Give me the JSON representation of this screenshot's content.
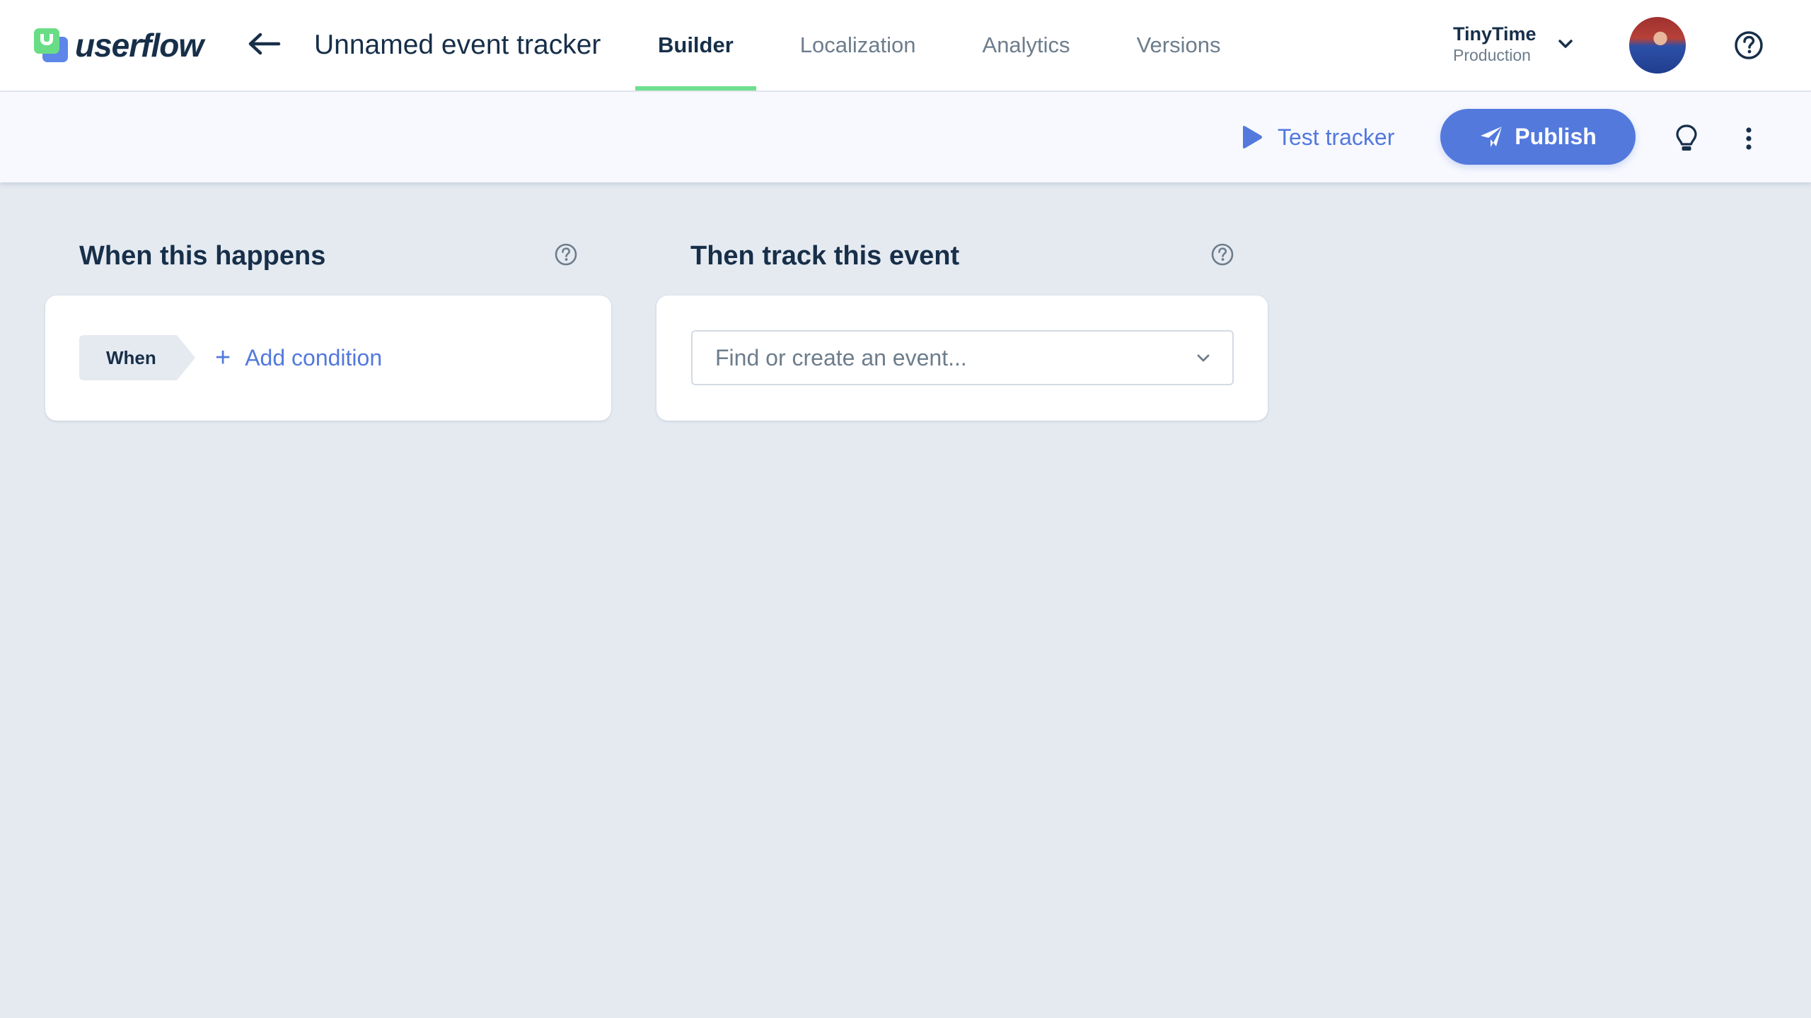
{
  "header": {
    "logo_text": "userflow",
    "title": "Unnamed event tracker",
    "tabs": [
      {
        "label": "Builder",
        "active": true
      },
      {
        "label": "Localization",
        "active": false
      },
      {
        "label": "Analytics",
        "active": false
      },
      {
        "label": "Versions",
        "active": false
      }
    ],
    "workspace": {
      "name": "TinyTime",
      "environment": "Production"
    },
    "icons": {
      "back": "arrow-left-icon",
      "workspace_dropdown": "chevron-down-icon",
      "avatar": "user-avatar",
      "help": "question-circle-icon"
    }
  },
  "toolbar": {
    "test_label": "Test tracker",
    "publish_label": "Publish",
    "icons": {
      "test": "play-icon",
      "publish": "paper-plane-icon",
      "tips": "lightbulb-icon",
      "more": "kebab-menu-icon"
    }
  },
  "colors": {
    "accent": "#5379dd",
    "active_tab_underline": "#6ee08f",
    "text_primary": "#172f49",
    "text_muted": "#6d7d8c",
    "background": "#e5eaf1",
    "logo_green": "#69dd86",
    "logo_blue": "#5d86e8"
  },
  "main": {
    "trigger_panel": {
      "title": "When this happens",
      "chip_label": "When",
      "add_condition_label": "Add condition"
    },
    "event_panel": {
      "title": "Then track this event",
      "event_select": {
        "placeholder": "Find or create an event...",
        "value": ""
      }
    }
  }
}
